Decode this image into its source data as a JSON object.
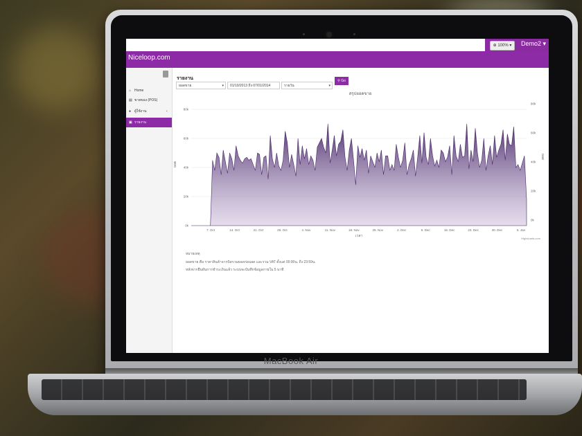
{
  "device": {
    "brand": "MacBook Air"
  },
  "topbar": {
    "zoom": "100%",
    "user": "Demo2"
  },
  "app": {
    "brand": "Niceloop.com",
    "color": "#8d2aa5"
  },
  "sidebar": {
    "items": [
      {
        "icon": "home-icon",
        "label": "Home",
        "active": false
      },
      {
        "icon": "cart-icon",
        "label": "ขายของ (POS)",
        "active": false
      },
      {
        "icon": "user-icon",
        "label": "ผู้ใช้งาน",
        "active": false
      },
      {
        "icon": "chart-icon",
        "label": "รายงาน",
        "active": true
      }
    ]
  },
  "report": {
    "heading": "รายงาน",
    "filter_type": "ยอดขาย",
    "date_range": "01/10/2013 ถึง 07/01/2014",
    "filter_group": "รายวัน",
    "go_label": "Go",
    "chart_title": "สรุปยอดขาย",
    "credit": "Highcharts.com"
  },
  "chart_data": {
    "type": "area",
    "title": "สรุปยอดขาย",
    "x_ticks": [
      "7. Oct",
      "14. Oct",
      "21. Oct",
      "28. Oct",
      "4. Nov",
      "11. Nov",
      "18. Nov",
      "25. Nov",
      "2. Dec",
      "9. Dec",
      "16. Dec",
      "23. Dec",
      "30. Dec",
      "6. Jan"
    ],
    "y_ticks_left": [
      "0k",
      "20k",
      "40k",
      "60k",
      "80k"
    ],
    "y_ticks_right": [
      "0k",
      "20k",
      "40k",
      "60k",
      "80k"
    ],
    "xlabel": "เวลา",
    "ylabel": "ยอด",
    "ylim": [
      0,
      80000
    ],
    "series": [
      {
        "values": [
          0,
          0,
          0,
          0,
          0,
          0,
          0,
          0,
          0,
          0,
          45000,
          38000,
          50000,
          47000,
          35000,
          52000,
          44000,
          36000,
          50000,
          46000,
          38000,
          55000,
          48000,
          45000,
          43000,
          46000,
          47000,
          45000,
          46000,
          42000,
          38000,
          50000,
          49000,
          35000,
          47000,
          48000,
          32000,
          62000,
          46000,
          40000,
          50000,
          41000,
          38000,
          45000,
          65000,
          57000,
          40000,
          49000,
          42000,
          34000,
          60000,
          42000,
          55000,
          46000,
          53000,
          42000,
          48000,
          45000,
          38000,
          54000,
          57000,
          60000,
          54000,
          50000,
          70000,
          43000,
          52000,
          62000,
          48000,
          56000,
          58000,
          66000,
          47000,
          38000,
          52000,
          60000,
          45000,
          28000,
          55000,
          47000,
          53000,
          45000,
          52000,
          36000,
          48000,
          44000,
          40000,
          50000,
          44000,
          52000,
          35000,
          48000,
          48000,
          38000,
          42000,
          38000,
          56000,
          47000,
          40000,
          45000,
          57000,
          35000,
          42000,
          46000,
          52000,
          34000,
          47000,
          62000,
          43000,
          64000,
          47000,
          42000,
          60000,
          48000,
          41000,
          45000,
          40000,
          52000,
          50000,
          44000,
          47000,
          55000,
          35000,
          62000,
          48000,
          44000,
          56000,
          47000,
          48000,
          70000,
          39000,
          52000,
          44000,
          67000,
          50000,
          40000,
          45000,
          60000,
          38000,
          48000,
          55000,
          42000,
          62000,
          47000,
          52000,
          56000,
          66000,
          45000,
          63000,
          56000,
          55000,
          68000,
          40000,
          42000,
          38000,
          43000,
          48000,
          18000
        ]
      }
    ]
  },
  "notes": [
    "หมายเหตุ",
    "ยอดขาย คือ ราคาสินค้าจากบิลรวมยอดก่อนลด และรวม VAT ตั้งแต่ 00:00น. ถึง 23:59น.",
    "หลังจากยืนยันการชำระเงินแล้ว ระบบจะบันทึกข้อมูลภายใน 5 นาที"
  ]
}
